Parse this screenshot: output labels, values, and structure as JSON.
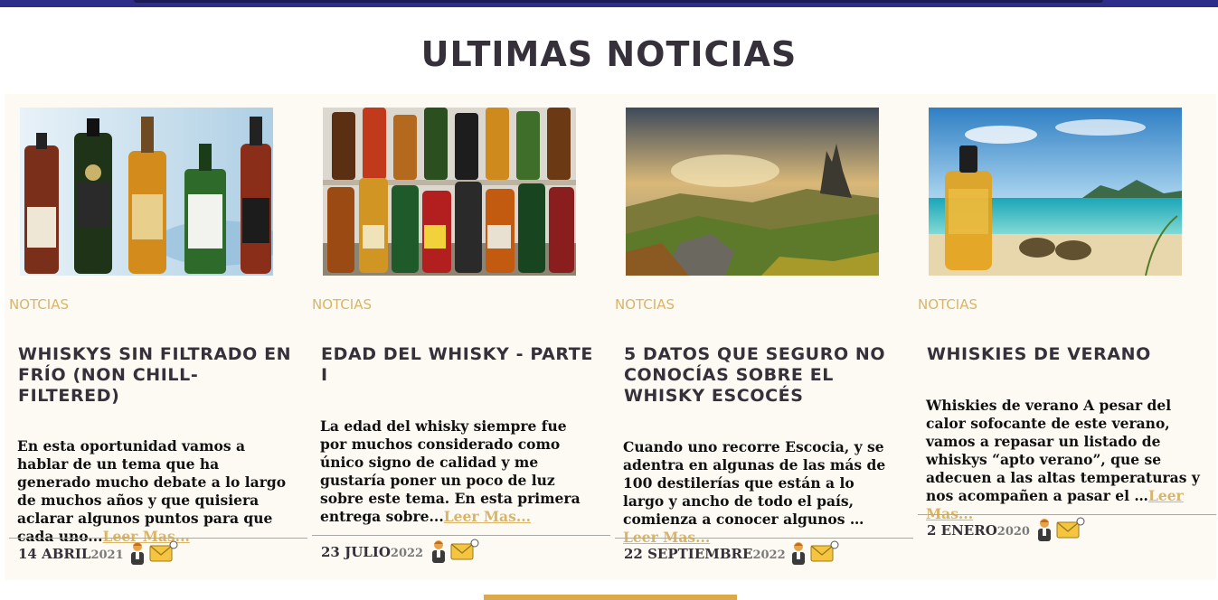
{
  "section": {
    "title": "ULTIMAS NOTICIAS"
  },
  "posts": [
    {
      "category": "NOTCIAS",
      "title": "WHISKYS SIN FILTRADO EN FRÍO (NON CHILL-FILTERED)",
      "excerpt": "En esta oportunidad vamos a hablar de un tema que ha generado mucho debate a lo largo de muchos años y que quisiera aclarar algunos puntos para que cada uno...",
      "read_more": "Leer Mas...",
      "date": "14 ABRIL",
      "year": "2021",
      "image": "whisky-bottles-lineup"
    },
    {
      "category": "NOTCIAS",
      "title": "EDAD DEL WHISKY - PARTE I",
      "excerpt": "La edad del whisky siempre fue por muchos considerado como único signo de calidad y me gustaría poner un poco de luz sobre este tema. En esta primera entrega sobre...",
      "read_more": "Leer Mas...",
      "date": "23 JULIO",
      "year": "2022",
      "image": "liquor-shelf"
    },
    {
      "category": "NOTCIAS",
      "title": "5 DATOS QUE SEGURO NO CONOCÍAS SOBRE EL WHISKY ESCOCÉS",
      "excerpt": "Cuando uno recorre Escocia, y se adentra en algunas de las más de 100 destilerías que están a lo largo y ancho de todo el país, comienza a conocer algunos …",
      "read_more": "Leer Mas...",
      "date": "22 SEPTIEMBRE",
      "year": "2022",
      "image": "scottish-highlands"
    },
    {
      "category": "NOTCIAS",
      "title": "WHISKIES DE VERANO",
      "excerpt": "Whiskies de verano A pesar del calor sofocante de este verano, vamos a repasar un listado de whiskys “apto verano”, que se adecuen a las altas temperaturas y nos acompañen a pasar el …",
      "read_more": "Leer Mas...",
      "date": "2 ENERO",
      "year": "2020",
      "image": "whisky-flask-beach"
    }
  ],
  "icons": {
    "author": "author-icon",
    "mail": "mail-icon"
  },
  "colors": {
    "accent": "#d9b46a",
    "title": "#36303a",
    "card_bg": "#fdfaf3",
    "topbar": "#2e2e8a"
  }
}
